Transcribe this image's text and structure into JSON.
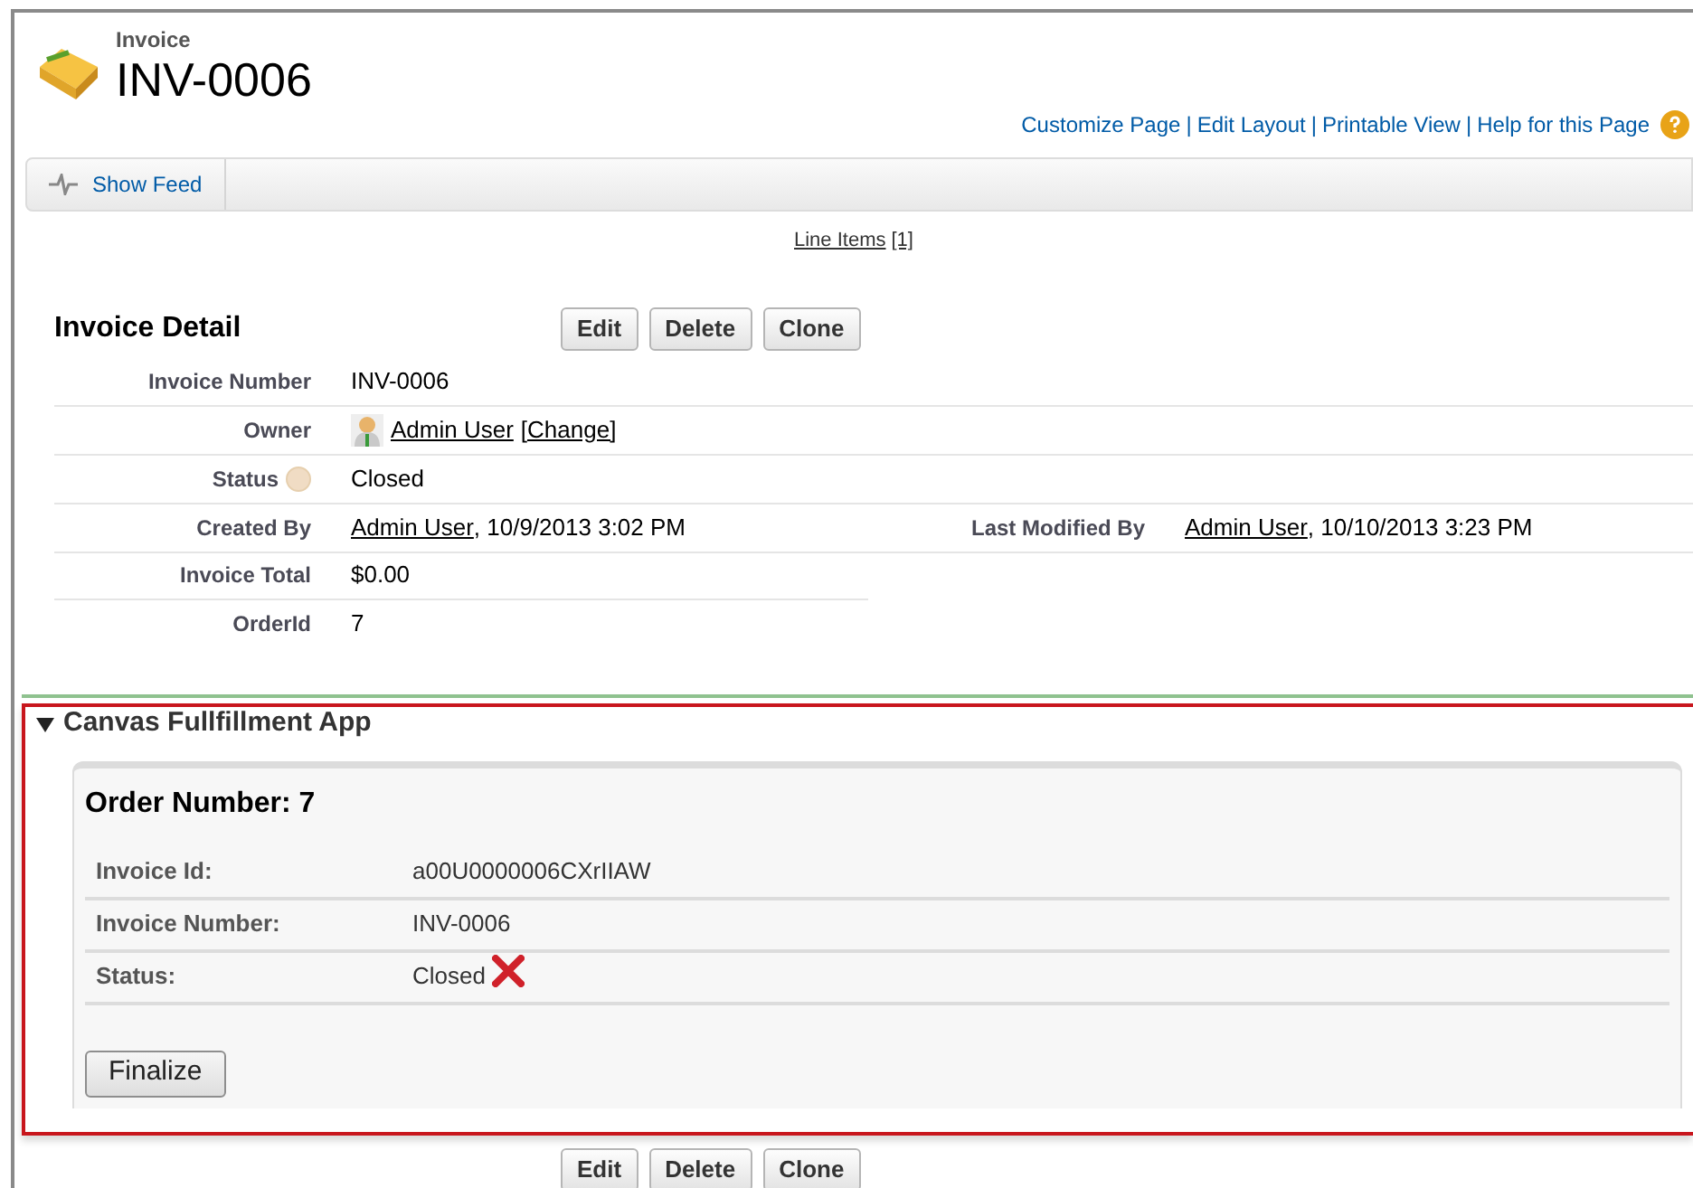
{
  "header": {
    "object_type": "Invoice",
    "title": "INV-0006"
  },
  "top_links": [
    {
      "kind": "link",
      "text": "Customize Page"
    },
    {
      "kind": "separator",
      "text": "|"
    },
    {
      "kind": "link",
      "text": "Edit Layout"
    },
    {
      "kind": "separator",
      "text": "|"
    },
    {
      "kind": "link",
      "text": "Printable View"
    },
    {
      "kind": "separator",
      "text": "|"
    },
    {
      "kind": "link",
      "text": "Help for this Page"
    }
  ],
  "feed_button": "Show Feed",
  "related_link": {
    "label": "Line Items",
    "count": "[1]"
  },
  "detail": {
    "title": "Invoice Detail",
    "buttons": [
      "Edit",
      "Delete",
      "Clone"
    ],
    "rows": [
      {
        "left": {
          "label": "Invoice Number",
          "value": [
            {
              "text": "INV-0006",
              "link": false
            }
          ]
        }
      },
      {
        "left": {
          "label": "Owner",
          "avatar": true,
          "value": [
            {
              "text": "Admin User",
              "link": true
            },
            {
              "text": "[Change]",
              "link": true
            }
          ]
        }
      },
      {
        "left": {
          "label": "Status",
          "help": true,
          "value": [
            {
              "text": "Closed",
              "link": false
            }
          ]
        }
      },
      {
        "left": {
          "label": "Created By",
          "value": [
            {
              "text": "Admin User",
              "link": true
            },
            {
              "text": ", 10/9/2013 3:02 PM",
              "link": false
            }
          ]
        },
        "right": {
          "label": "Last Modified By",
          "value": [
            {
              "text": "Admin User",
              "link": true
            },
            {
              "text": ", 10/10/2013 3:23 PM",
              "link": false
            }
          ]
        }
      },
      {
        "left": {
          "label": "Invoice Total",
          "value": [
            {
              "text": "$0.00",
              "link": false
            }
          ]
        }
      },
      {
        "left": {
          "label": "OrderId",
          "value": [
            {
              "text": "7",
              "link": false
            }
          ]
        }
      }
    ]
  },
  "canvas_section": {
    "title": "Canvas Fullfillment App",
    "expanded": true,
    "app": {
      "heading": "Order Number: 7",
      "fields": [
        {
          "label": "Invoice Id:",
          "value": "a00U0000006CXrIIAW"
        },
        {
          "label": "Invoice Number:",
          "value": "INV-0006"
        },
        {
          "label": "Status:",
          "value": "Closed",
          "error": true
        }
      ],
      "button": "Finalize"
    }
  },
  "bottom_buttons": [
    "Edit",
    "Delete",
    "Clone"
  ]
}
